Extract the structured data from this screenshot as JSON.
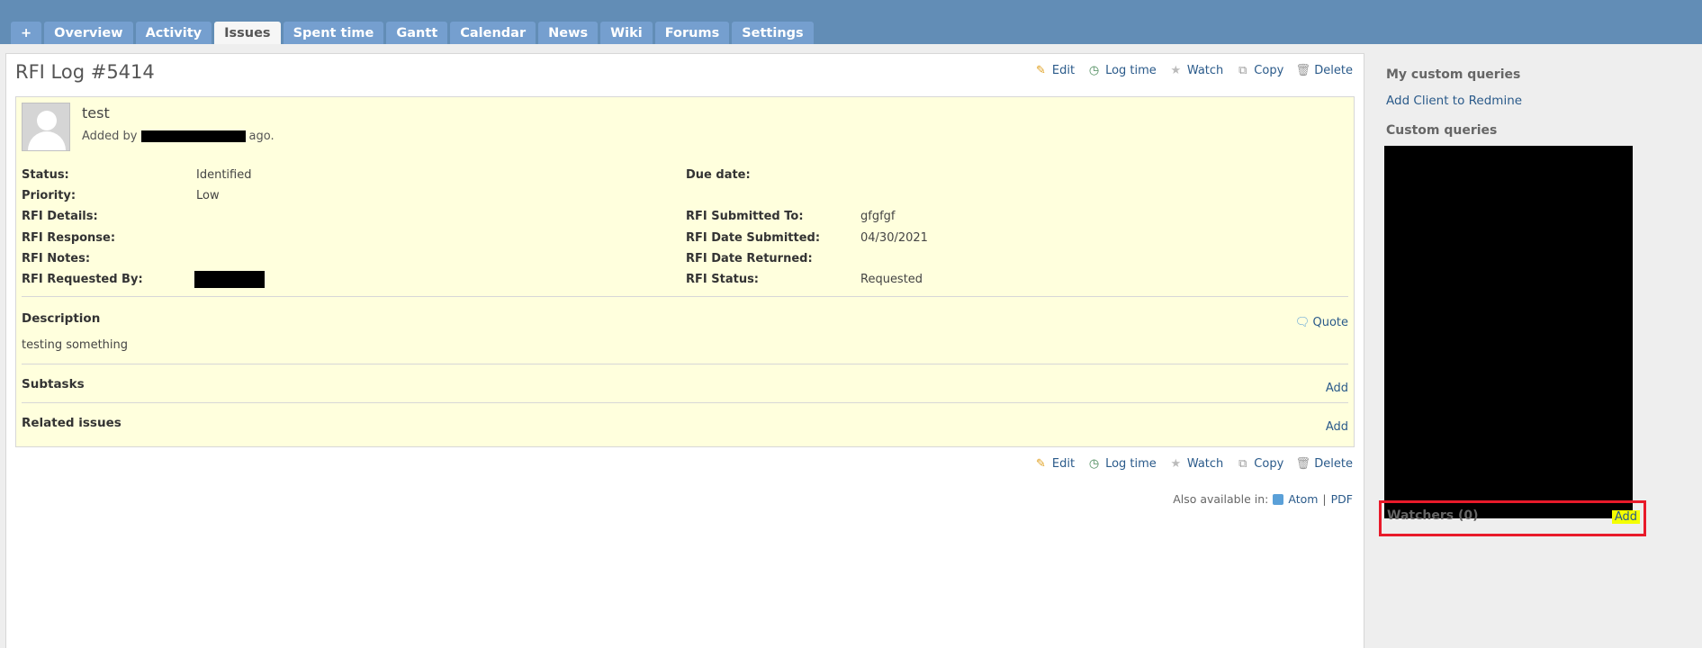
{
  "tabs": [
    {
      "label": "+"
    },
    {
      "label": "Overview"
    },
    {
      "label": "Activity"
    },
    {
      "label": "Issues",
      "selected": true
    },
    {
      "label": "Spent time"
    },
    {
      "label": "Gantt"
    },
    {
      "label": "Calendar"
    },
    {
      "label": "News"
    },
    {
      "label": "Wiki"
    },
    {
      "label": "Forums"
    },
    {
      "label": "Settings"
    }
  ],
  "issue": {
    "title": "RFI Log #5414",
    "subject": "test",
    "added_prefix": "Added by",
    "added_suffix": "ago."
  },
  "actions": {
    "edit": "Edit",
    "log_time": "Log time",
    "watch": "Watch",
    "copy": "Copy",
    "delete": "Delete"
  },
  "attributes_left": [
    {
      "label": "Status:",
      "value": "Identified"
    },
    {
      "label": "Priority:",
      "value": "Low"
    },
    {
      "label": "RFI Details:",
      "value": ""
    },
    {
      "label": "RFI Response:",
      "value": ""
    },
    {
      "label": "RFI Notes:",
      "value": ""
    },
    {
      "label": "RFI Requested By:",
      "value": ""
    }
  ],
  "attributes_right": [
    {
      "label": "Due date:",
      "value": ""
    },
    {
      "label": "RFI Submitted To:",
      "value": "gfgfgf"
    },
    {
      "label": "RFI Date Submitted:",
      "value": "04/30/2021"
    },
    {
      "label": "RFI Date Returned:",
      "value": ""
    },
    {
      "label": "RFI Status:",
      "value": "Requested"
    }
  ],
  "description": {
    "title": "Description",
    "quote": "Quote",
    "text": "testing something"
  },
  "subtasks": {
    "title": "Subtasks",
    "add": "Add"
  },
  "related": {
    "title": "Related issues",
    "add": "Add"
  },
  "also_available": {
    "prefix": "Also available in:",
    "atom": "Atom",
    "separator": "|",
    "pdf": "PDF"
  },
  "sidebar": {
    "my_queries_title": "My custom queries",
    "my_query_link": "Add Client to Redmine",
    "custom_queries_title": "Custom queries",
    "watchers_title": "Watchers (0)",
    "watchers_add": "Add"
  },
  "colors": {
    "header_bg": "#628db6",
    "tab_bg": "#759fcf",
    "issue_bg": "#ffffdd",
    "highlight_border": "#e81a2a",
    "highlight_fill": "#f4ff00"
  }
}
